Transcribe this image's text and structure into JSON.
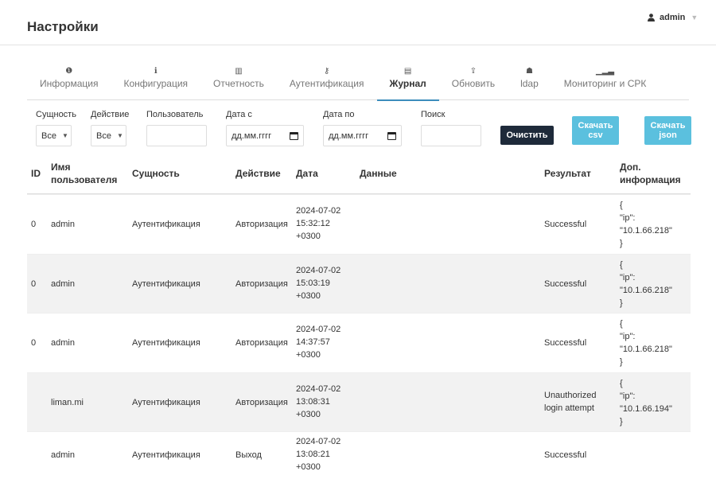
{
  "header": {
    "title": "Настройки",
    "user": "admin",
    "user_icon": "user-icon",
    "caret_icon": "chevron-down-icon"
  },
  "tabs": [
    {
      "label": "Информация",
      "icon": "info-circle-icon",
      "glyph": "❶"
    },
    {
      "label": "Конфигурация",
      "icon": "info-icon",
      "glyph": "ℹ"
    },
    {
      "label": "Отчетность",
      "icon": "bar-chart-icon",
      "glyph": "▥"
    },
    {
      "label": "Аутентификация",
      "icon": "key-icon",
      "glyph": "⚷"
    },
    {
      "label": "Журнал",
      "icon": "file-icon",
      "glyph": "▤",
      "active": true
    },
    {
      "label": "Обновить",
      "icon": "upload-icon",
      "glyph": "⇪"
    },
    {
      "label": "ldap",
      "icon": "users-icon",
      "glyph": "☗"
    },
    {
      "label": "Мониторинг и СРК",
      "icon": "signal-icon",
      "glyph": "▁▂▃"
    }
  ],
  "filters": {
    "entity_label": "Сущность",
    "entity_value": "Все",
    "action_label": "Действие",
    "action_value": "Все",
    "user_label": "Пользователь",
    "user_value": "",
    "date_from_label": "Дата с",
    "date_from_placeholder": "дд.мм.гггг",
    "date_to_label": "Дата по",
    "date_to_placeholder": "дд.мм.гггг",
    "search_label": "Поиск",
    "search_value": ""
  },
  "buttons": {
    "clear": "Очистить",
    "csv_line1": "Скачать",
    "csv_line2": "csv",
    "json_line1": "Скачать",
    "json_line2": "json"
  },
  "table": {
    "headers": {
      "id": "ID",
      "user_l1": "Имя",
      "user_l2": "пользователя",
      "entity": "Сущность",
      "action": "Действие",
      "date": "Дата",
      "data": "Данные",
      "result": "Результат",
      "extra_l1": "Доп.",
      "extra_l2": "информация"
    },
    "rows": [
      {
        "id": "0",
        "user": "admin",
        "entity": "Аутентификация",
        "action": "Авторизация",
        "date_l1": "2024-07-02",
        "date_l2": "15:32:12",
        "date_l3": "+0300",
        "data": "",
        "result_l1": "Successful",
        "result_l2": "",
        "extra_l1": "{",
        "extra_l2": "\"ip\":",
        "extra_l3": "\"10.1.66.218\"",
        "extra_l4": "}"
      },
      {
        "id": "0",
        "user": "admin",
        "entity": "Аутентификация",
        "action": "Авторизация",
        "date_l1": "2024-07-02",
        "date_l2": "15:03:19",
        "date_l3": "+0300",
        "data": "",
        "result_l1": "Successful",
        "result_l2": "",
        "extra_l1": "{",
        "extra_l2": "\"ip\":",
        "extra_l3": "\"10.1.66.218\"",
        "extra_l4": "}"
      },
      {
        "id": "0",
        "user": "admin",
        "entity": "Аутентификация",
        "action": "Авторизация",
        "date_l1": "2024-07-02",
        "date_l2": "14:37:57",
        "date_l3": "+0300",
        "data": "",
        "result_l1": "Successful",
        "result_l2": "",
        "extra_l1": "{",
        "extra_l2": "\"ip\":",
        "extra_l3": "\"10.1.66.218\"",
        "extra_l4": "}"
      },
      {
        "id": "",
        "user": "liman.mi",
        "entity": "Аутентификация",
        "action": "Авторизация",
        "date_l1": "2024-07-02",
        "date_l2": "13:08:31",
        "date_l3": "+0300",
        "data": "",
        "result_l1": "Unauthorized",
        "result_l2": "login attempt",
        "extra_l1": "{",
        "extra_l2": "\"ip\":",
        "extra_l3": "\"10.1.66.194\"",
        "extra_l4": "}"
      },
      {
        "id": "",
        "user": "admin",
        "entity": "Аутентификация",
        "action": "Выход",
        "date_l1": "2024-07-02",
        "date_l2": "13:08:21",
        "date_l3": "+0300",
        "data": "",
        "result_l1": "Successful",
        "result_l2": "",
        "extra_l1": "",
        "extra_l2": "",
        "extra_l3": "",
        "extra_l4": ""
      }
    ]
  },
  "colors": {
    "accent": "#3c8dbc",
    "dark_button": "#1e2a3a",
    "info_button": "#5bc0de",
    "stripe": "#f2f2f2"
  }
}
